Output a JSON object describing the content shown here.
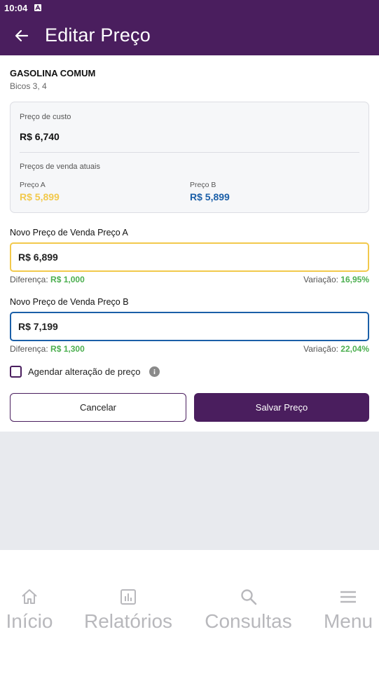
{
  "status_bar": {
    "time": "10:04"
  },
  "app_bar": {
    "title": "Editar Preço",
    "back_icon": "arrow-back-icon"
  },
  "product": {
    "name": "GASOLINA COMUM",
    "nozzles": "Bicos 3, 4"
  },
  "summary_card": {
    "cost_label": "Preço de custo",
    "cost_value": "R$ 6,740",
    "current_label": "Preços de venda atuais",
    "price_a_label": "Preço A",
    "price_a_value": "R$ 5,899",
    "price_b_label": "Preço B",
    "price_b_value": "R$ 5,899"
  },
  "field_a": {
    "label": "Novo Preço de Venda Preço A",
    "value": "R$ 6,899",
    "diff_label": "Diferença:",
    "diff_value": "R$ 1,000",
    "var_label": "Variação:",
    "var_value": "16,95%"
  },
  "field_b": {
    "label": "Novo Preço de Venda Preço B",
    "value": "R$ 7,199",
    "diff_label": "Diferença:",
    "diff_value": "R$ 1,300",
    "var_label": "Variação:",
    "var_value": "22,04%"
  },
  "schedule": {
    "label": "Agendar alteração de preço",
    "checked": false
  },
  "buttons": {
    "cancel": "Cancelar",
    "save": "Salvar Preço"
  },
  "bottom_nav": [
    {
      "label": "Início",
      "icon": "home-icon"
    },
    {
      "label": "Relatórios",
      "icon": "chart-icon"
    },
    {
      "label": "Consultas",
      "icon": "search-icon"
    },
    {
      "label": "Menu",
      "icon": "menu-icon"
    }
  ],
  "colors": {
    "brand": "#4a1e5e",
    "price_a": "#f2c94c",
    "price_b": "#1b5fa8",
    "positive": "#4caf50"
  }
}
